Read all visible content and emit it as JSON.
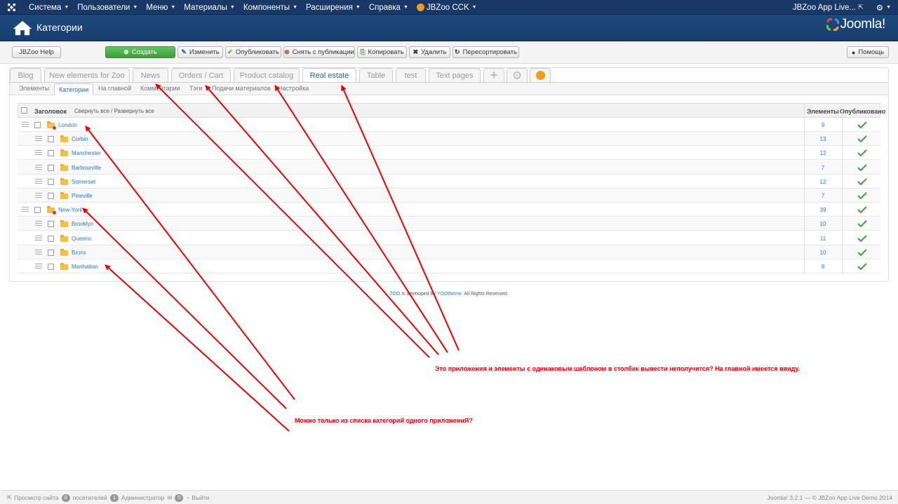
{
  "topbar": {
    "menu": [
      {
        "label": "Система"
      },
      {
        "label": "Пользователи"
      },
      {
        "label": "Меню"
      },
      {
        "label": "Материалы"
      },
      {
        "label": "Компоненты"
      },
      {
        "label": "Расширения"
      },
      {
        "label": "Справка"
      },
      {
        "label": "JBZoo CCK"
      }
    ],
    "site_name": "JBZoo App Live..."
  },
  "header": {
    "title": "Категории",
    "brand": "Joomla!"
  },
  "toolbar": {
    "help_left": "JBZoo Help",
    "create": "Создать",
    "edit": "Изменить",
    "publish": "Опубликовать",
    "unpublish": "Снять с публикации",
    "copy": "Копировать",
    "delete": "Удалить",
    "resort": "Пересортировать",
    "help_right": "Помощь"
  },
  "app_tabs": [
    {
      "label": "Blog"
    },
    {
      "label": "New elements for Zoo"
    },
    {
      "label": "News"
    },
    {
      "label": "Orders / Cart"
    },
    {
      "label": "Product catalog"
    },
    {
      "label": "Real estate"
    },
    {
      "label": "Table"
    },
    {
      "label": "test"
    },
    {
      "label": "Text pages"
    }
  ],
  "subtabs": [
    {
      "label": "Элементы"
    },
    {
      "label": "Категории"
    },
    {
      "label": "На главной"
    },
    {
      "label": "Комментарии"
    },
    {
      "label": "Тэги"
    },
    {
      "label": "Подачи материалов"
    },
    {
      "label": "Настройка"
    }
  ],
  "table": {
    "col_title": "Заголовок",
    "collapse_expand": "Свернуть все / Развернуть все",
    "col_items": "Элементы",
    "col_published": "Опубликовано",
    "rows": [
      {
        "name": "London",
        "count": "9"
      },
      {
        "name": "Corbin",
        "count": "13"
      },
      {
        "name": "Manchester",
        "count": "12"
      },
      {
        "name": "Barbourville",
        "count": "7"
      },
      {
        "name": "Somerset",
        "count": "12"
      },
      {
        "name": "Pineville",
        "count": "7"
      },
      {
        "name": "New-York",
        "count": "39"
      },
      {
        "name": "Brooklyn",
        "count": "10"
      },
      {
        "name": "Queens",
        "count": "11"
      },
      {
        "name": "Bronx",
        "count": "10"
      },
      {
        "name": "Manhattan",
        "count": "8"
      }
    ]
  },
  "footer": {
    "zoo": "ZOO",
    "mid": " is developed by ",
    "yoo": "YOOtheme",
    "end": ". All Rights Reserved."
  },
  "statusbar": {
    "preview": "Просмотр сайта",
    "visitors_count": "0",
    "visitors": "посетителей",
    "admins_count": "1",
    "admins": "Администратор",
    "msg_count": "0",
    "logout": "Выйти",
    "version": "Joomla! 3.2.1 — © JBZoo App Live Demo 2014"
  },
  "annotations": {
    "note1": "Это приложения и элементы с одинаковым шаблоном в столбик вывести неполучится? На главной имеется ввиду.",
    "note2": "Можно только из списка категорий одного приложениЯ?"
  },
  "colors": {
    "topbar": "#1a3867",
    "header": "#1d4a7f",
    "link": "#2b78c5",
    "create": "#4cae4c",
    "annotation": "#ee0000"
  }
}
